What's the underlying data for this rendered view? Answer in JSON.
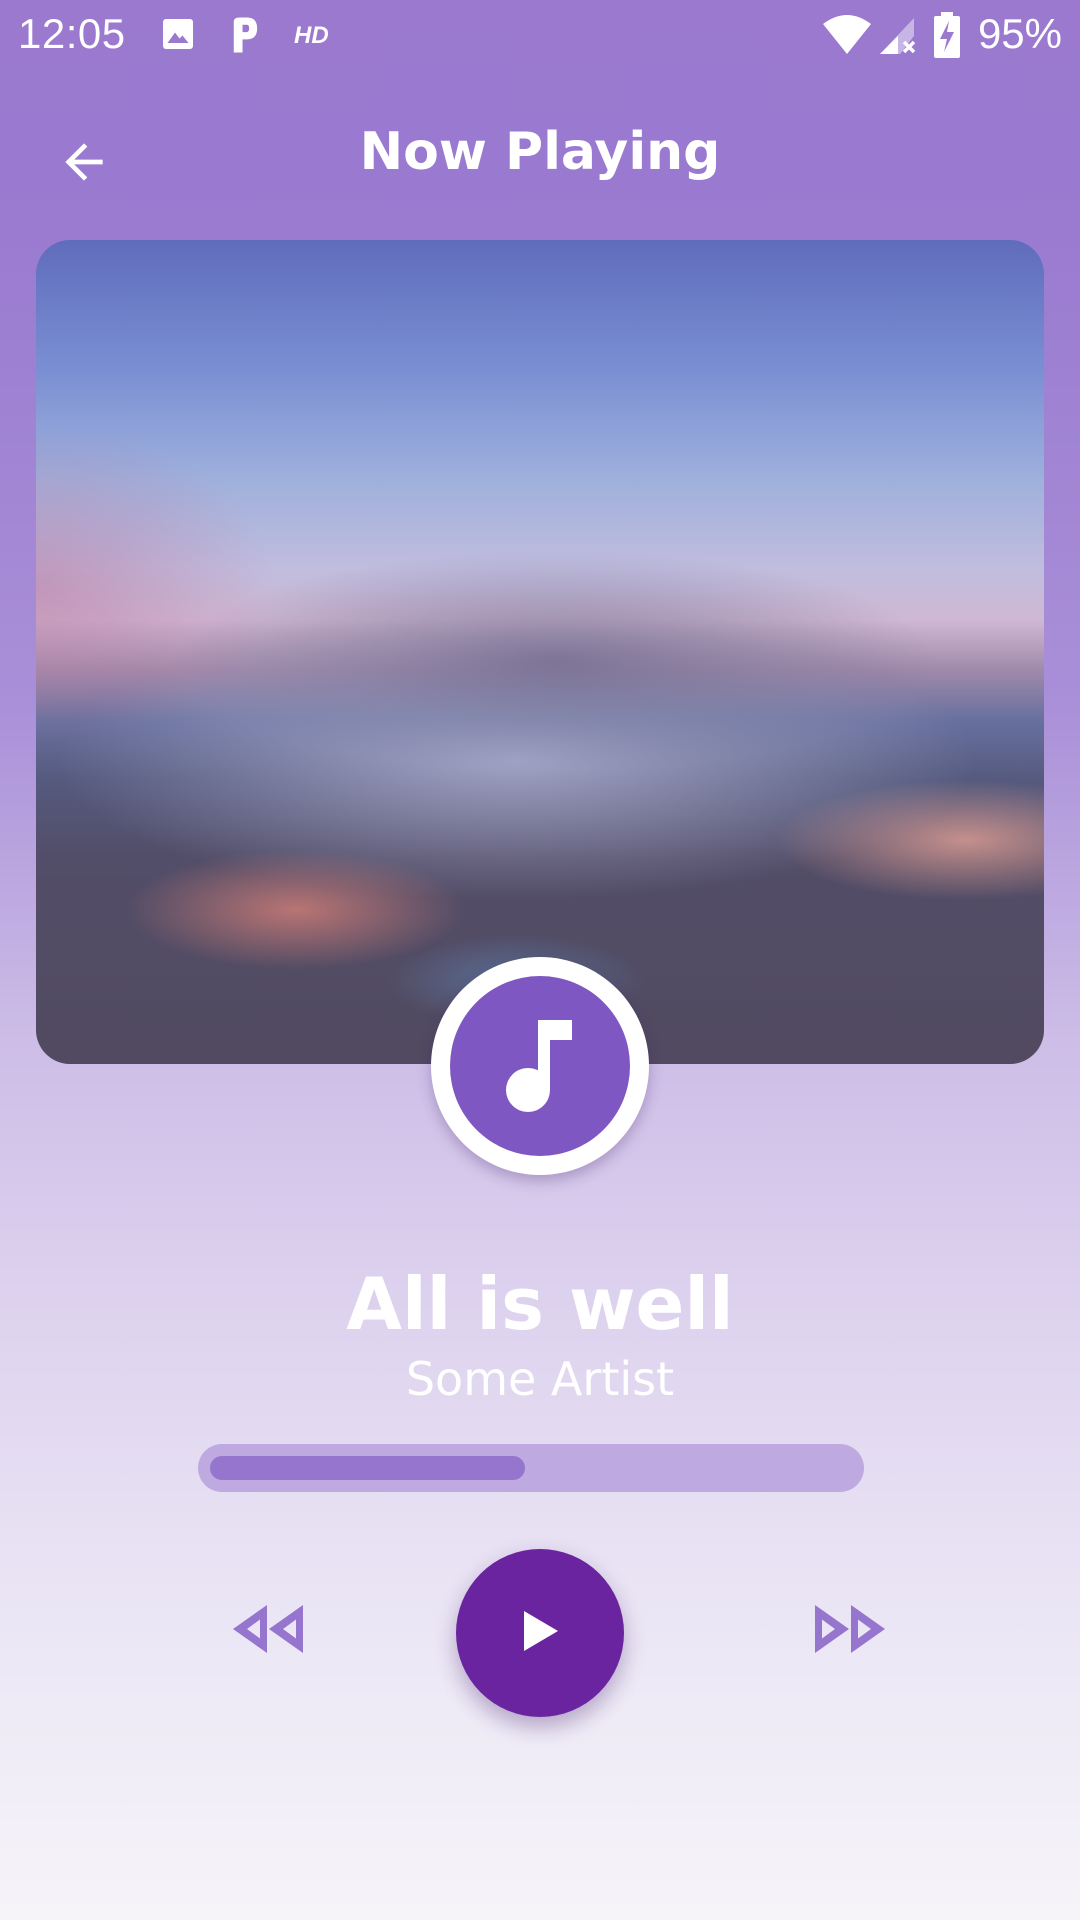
{
  "status_bar": {
    "time": "12:05",
    "notification_icons": [
      "image-icon",
      "p-app-icon"
    ],
    "hd_label": "HD",
    "battery": "95%",
    "system_icons": [
      "wifi-icon",
      "signal-icon",
      "battery-charging-icon"
    ]
  },
  "header": {
    "title": "Now Playing",
    "back_icon": "arrow-back-icon"
  },
  "album": {
    "badge_icon": "music-note-icon"
  },
  "track": {
    "title": "All is well",
    "artist": "Some Artist",
    "progress_fraction": 0.49
  },
  "controls": {
    "rewind_icon": "rewind-icon",
    "play_icon": "play-icon",
    "forward_icon": "fast-forward-icon"
  },
  "colors": {
    "accent": "#7e57c2",
    "play_button": "#6a24a0",
    "progress_track": "#bea9e0",
    "progress_fill": "#9575cd",
    "control_icons": "#9575cd"
  }
}
